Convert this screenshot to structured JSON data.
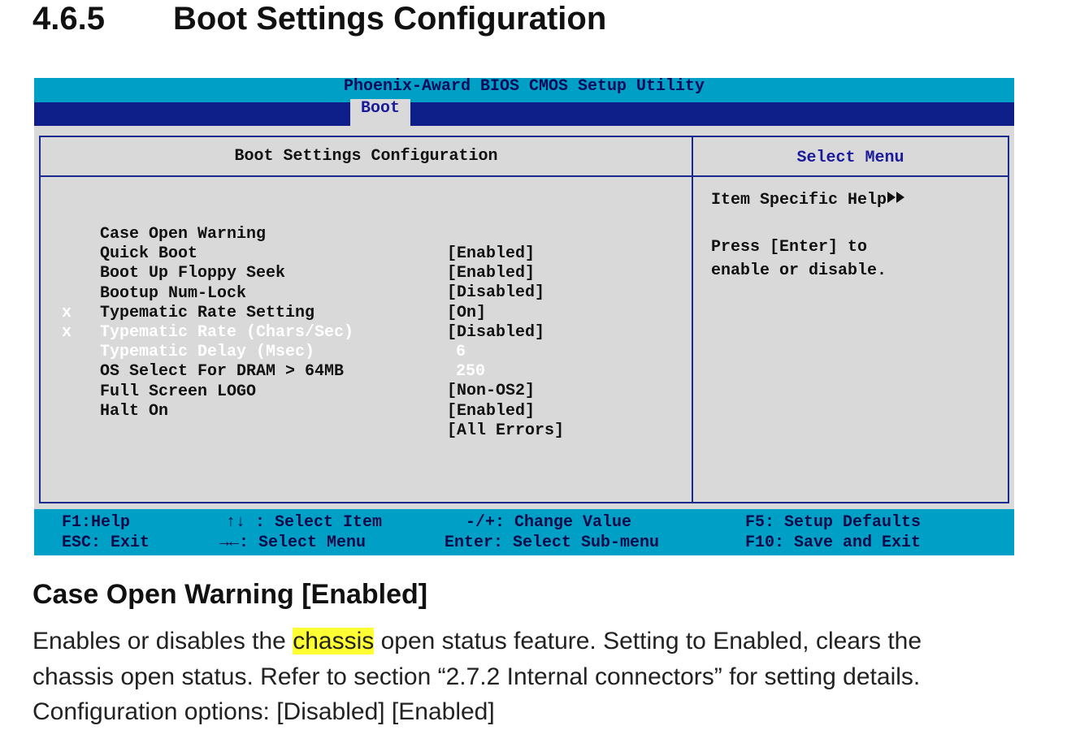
{
  "doc": {
    "section_number": "4.6.5",
    "section_title": "Boot Settings Configuration",
    "item_heading": "Case Open Warning [Enabled]",
    "description": {
      "pre": "Enables or disables the ",
      "highlight": "chassis",
      "post": " open status feature. Setting to Enabled, clears the",
      "line2": "chassis open status. Refer to section “2.7.2 Internal connectors” for setting details.",
      "line3": "Configuration options: [Disabled] [Enabled]"
    }
  },
  "bios": {
    "title": "Phoenix-Award BIOS CMOS Setup Utility",
    "active_tab": "Boot",
    "panel_title": "Boot Settings Configuration",
    "help_title": "Select Menu",
    "settings": [
      {
        "marker": "",
        "label": "Case Open Warning",
        "value": "[Enabled]"
      },
      {
        "marker": "",
        "label": "Quick Boot",
        "value": "[Enabled]"
      },
      {
        "marker": "",
        "label": "Boot Up Floppy Seek",
        "value": "[Disabled]"
      },
      {
        "marker": "",
        "label": "Bootup Num-Lock",
        "value": "[On]"
      },
      {
        "marker": "",
        "label": "Typematic Rate Setting",
        "value": "[Disabled]"
      },
      {
        "marker": "x",
        "label": "Typematic Rate (Chars/Sec)",
        "value": "6"
      },
      {
        "marker": "x",
        "label": "Typematic Delay (Msec)",
        "value": "250"
      },
      {
        "marker": "",
        "label": "OS Select For DRAM > 64MB",
        "value": "[Non-OS2]"
      },
      {
        "marker": "",
        "label": "Full Screen LOGO",
        "value": "[Enabled]"
      },
      {
        "marker": "",
        "label": "Halt On",
        "value": "[All Errors]"
      }
    ],
    "help": {
      "heading": "Item Specific Help",
      "arrows_icon": "double-right-arrow-icon",
      "line1": "Press [Enter] to",
      "line2": "enable or disable."
    },
    "footer": {
      "f1": "F1:Help",
      "esc": "ESC: Exit",
      "select_item": "↑↓ : Select Item",
      "select_menu": "→←: Select Menu",
      "change_value": "-/+: Change Value",
      "sub_menu": "Enter: Select Sub-menu",
      "f5": "F5: Setup Defaults",
      "f10": "F10: Save and Exit"
    },
    "colors": {
      "title_bar": "#00a0c6",
      "menu_bar": "#0f1f8a",
      "panel_bg": "#d9d9d9",
      "border": "#1a2a8a",
      "disabled_text": "#ffffff"
    }
  }
}
